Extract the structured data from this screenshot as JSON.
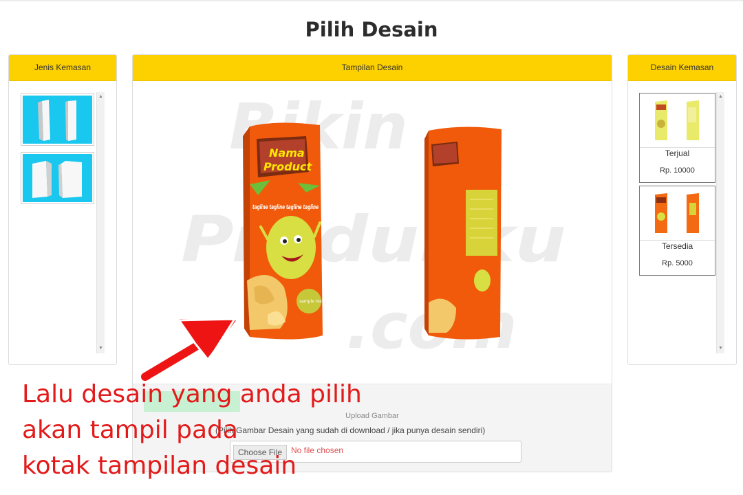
{
  "page": {
    "title": "Pilih Desain"
  },
  "left_panel": {
    "header": "Jenis Kemasan",
    "items": [
      {
        "icon": "tall-box-shape-icon"
      },
      {
        "icon": "square-box-shape-icon"
      }
    ]
  },
  "center_panel": {
    "header": "Tampilan Desain",
    "watermark": [
      "Bikin",
      "Produkku",
      ".com"
    ],
    "product": {
      "brand_line1": "Nama",
      "brand_line2": "Product",
      "tagline": "tagline tagline tagline tagline",
      "badge": "sample text"
    },
    "upload": {
      "button_label": "",
      "label": "Upload Gambar",
      "help": "(Pilih Gambar Desain yang sudah di download / jika punya desain sendiri)",
      "file_button": "Choose File",
      "file_status": "No file chosen"
    }
  },
  "right_panel": {
    "header": "Desain Kemasan",
    "designs": [
      {
        "name": "Terjual",
        "price": "Rp. 10000",
        "color": "#e9ea6a"
      },
      {
        "name": "Tersedia",
        "price": "Rp. 5000",
        "color": "#f36a12"
      }
    ]
  },
  "annotation": {
    "line1": "Lalu desain yang anda pilih",
    "line2": "akan tampil pada",
    "line3": "kotak tampilan desain"
  },
  "colors": {
    "header_yellow": "#fdd000",
    "package_orange": "#f05a0a",
    "annotation_red": "#e21a1a",
    "thumb_cyan": "#19c7ef"
  }
}
